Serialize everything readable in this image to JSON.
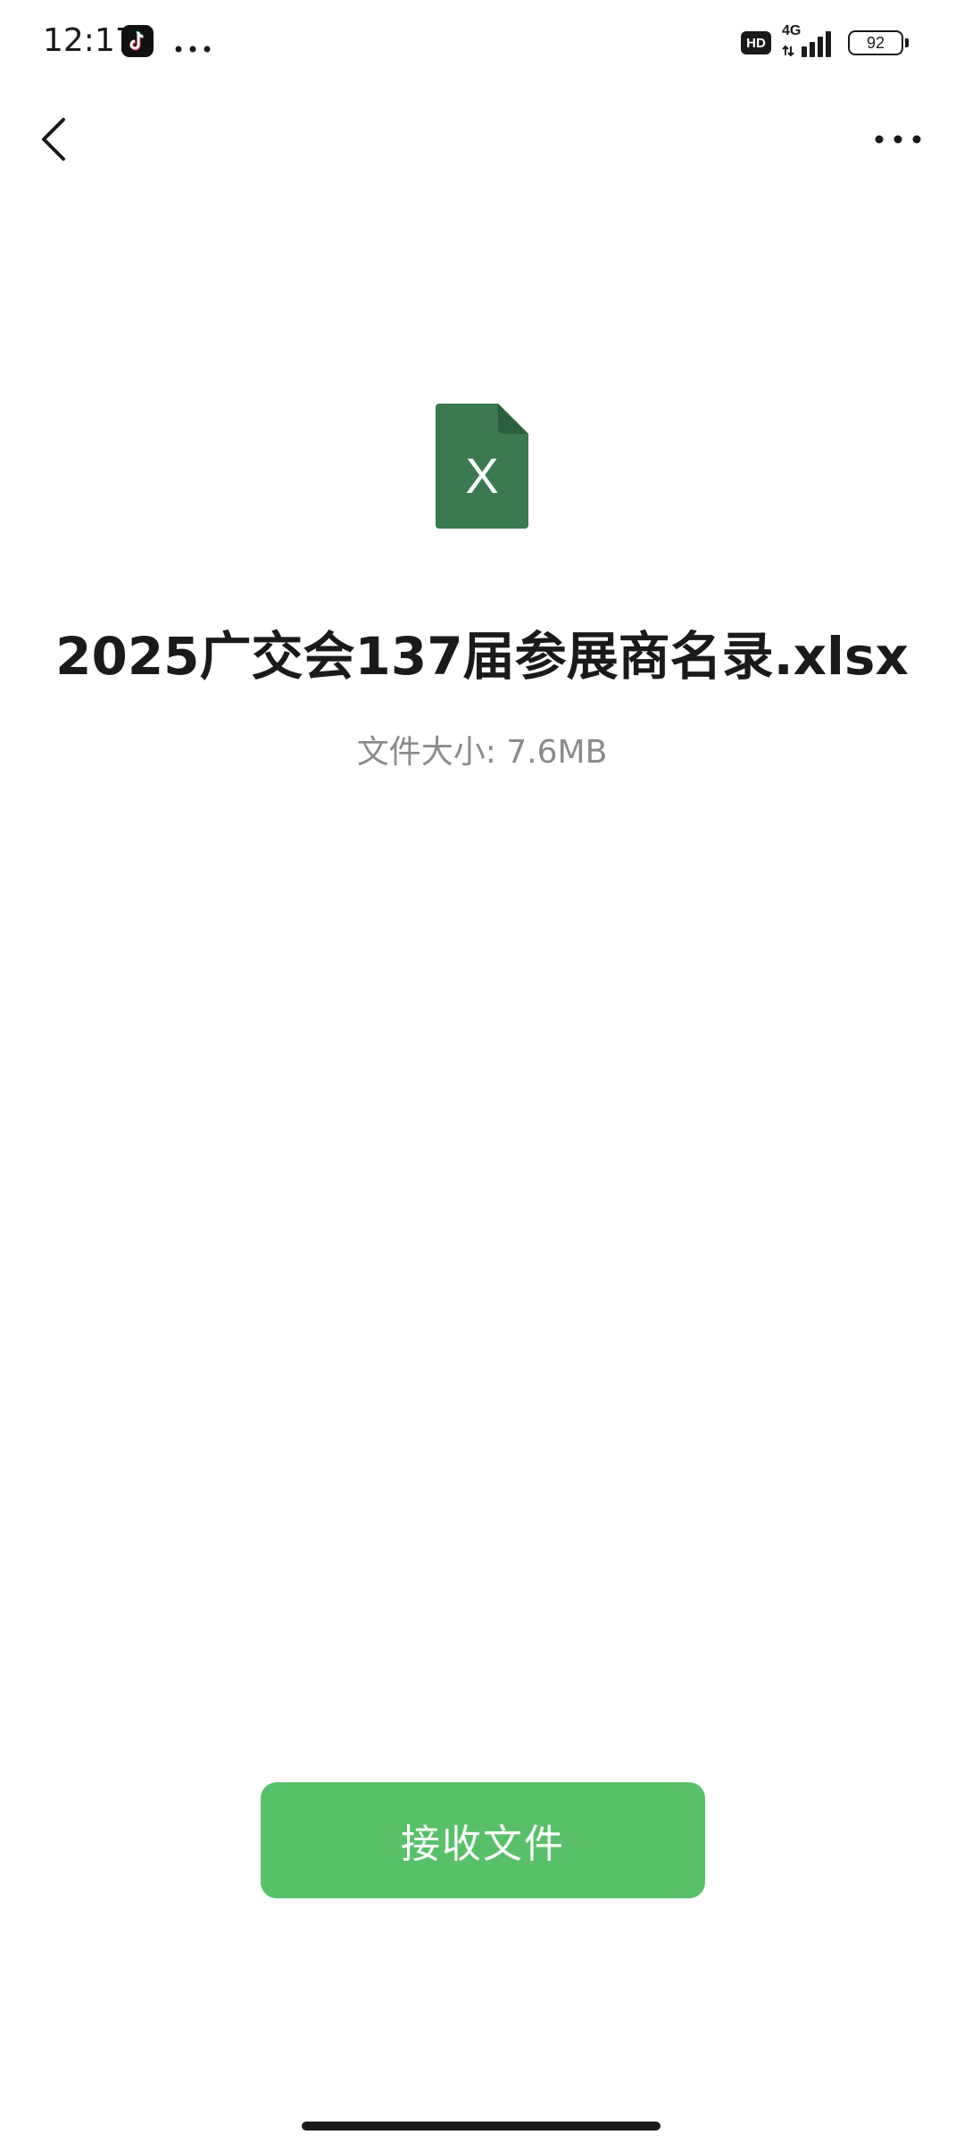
{
  "status_bar": {
    "time": "12:17",
    "app_icon": "tiktok-icon",
    "hd_badge": "HD",
    "network": "4G",
    "battery": "92"
  },
  "nav": {
    "back_icon": "chevron-left-icon",
    "more_icon": "more-horizontal-icon"
  },
  "file": {
    "icon": "excel-file-icon",
    "icon_letter": "X",
    "icon_color": "#3a7a4e",
    "name": "2025广交会137届参展商名录.xlsx",
    "size": "文件大小: 7.6MB"
  },
  "actions": {
    "receive_label": "接收文件",
    "receive_color": "#59c06a"
  }
}
